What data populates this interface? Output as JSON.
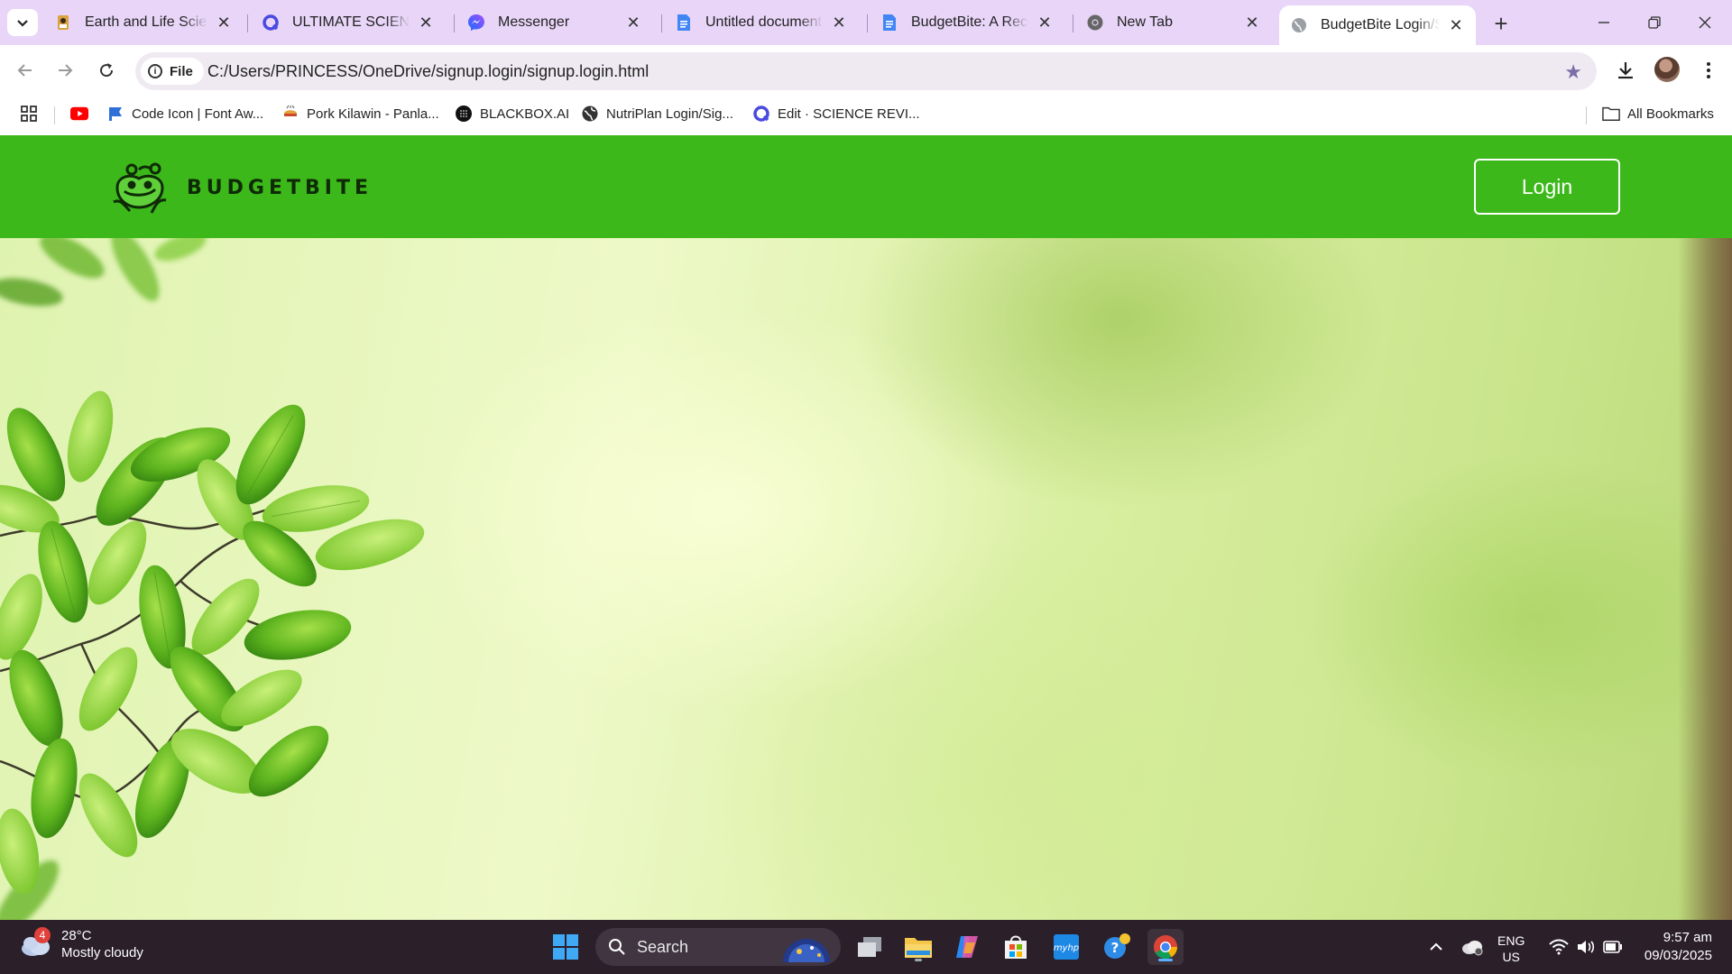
{
  "browser": {
    "tabs": [
      {
        "title": "Earth and Life Science",
        "icon": "book-favicon",
        "active": false
      },
      {
        "title": "ULTIMATE SCIENCE R",
        "icon": "quizizz-favicon",
        "active": false
      },
      {
        "title": "Messenger",
        "icon": "messenger-favicon",
        "active": false
      },
      {
        "title": "Untitled document -",
        "icon": "google-docs-favicon",
        "active": false
      },
      {
        "title": "BudgetBite: A Recipe",
        "icon": "google-docs-favicon",
        "active": false
      },
      {
        "title": "New Tab",
        "icon": "chrome-favicon",
        "active": false
      },
      {
        "title": "BudgetBite Login/Sig",
        "icon": "globe-favicon",
        "active": true
      }
    ],
    "address": {
      "scheme_label": "File",
      "url": "C:/Users/PRINCESS/OneDrive/signup.login/signup.login.html"
    },
    "bookmarks": [
      {
        "label": "",
        "icon": "youtube-icon"
      },
      {
        "label": "Code Icon | Font Aw...",
        "icon": "flag-icon"
      },
      {
        "label": "Pork Kilawin - Panla...",
        "icon": "recipe-icon"
      },
      {
        "label": "BLACKBOX.AI",
        "icon": "blackbox-icon"
      },
      {
        "label": "NutriPlan Login/Sig...",
        "icon": "globe-icon"
      },
      {
        "label": "Edit · SCIENCE REVI...",
        "icon": "quizizz-icon"
      }
    ],
    "all_bookmarks_label": "All Bookmarks"
  },
  "site": {
    "brand": "BUDGETBITE",
    "login_label": "Login",
    "header_color": "#3cb81a"
  },
  "taskbar": {
    "weather": {
      "badge": "4",
      "temperature": "28°C",
      "condition": "Mostly cloudy"
    },
    "search_label": "Search",
    "language": {
      "line1": "ENG",
      "line2": "US"
    },
    "time": "9:57 am",
    "date": "09/03/2025"
  }
}
